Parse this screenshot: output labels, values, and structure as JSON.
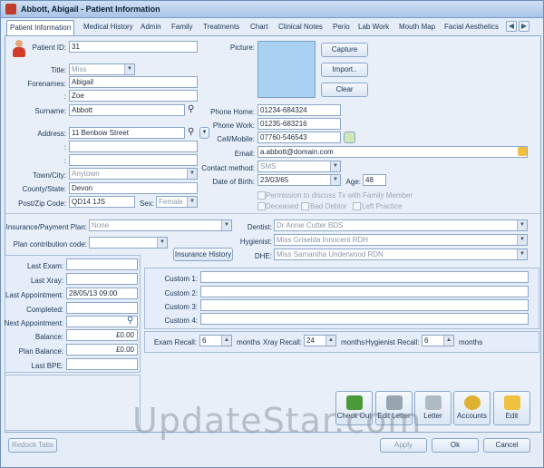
{
  "window": {
    "title": "Abbott, Abigail - Patient Information"
  },
  "tabs": [
    "Patient Information",
    "Medical History",
    "Admin",
    "Family",
    "Treatments",
    "Chart",
    "Clinical Notes",
    "Perio",
    "Lab Work",
    "Mouth Map",
    "Facial Aesthetics"
  ],
  "nav": {
    "prev": "◀",
    "next": "▶"
  },
  "patient": {
    "id_label": "Patient ID:",
    "id": "31",
    "title_label": "Title:",
    "title": "Miss",
    "forenames_label": "Forenames:",
    "forename1": "Abigail",
    "colon": ":",
    "forename2": "Zoe",
    "surname_label": "Surname:",
    "surname": "Abbott",
    "address_label": "Address:",
    "address1": "11 Benbow Street",
    "address2": "",
    "address3": "",
    "town_label": "Town/City:",
    "town": "Anytown",
    "county_label": "County/State:",
    "county": "Devon",
    "post_label": "Post/Zip Code:",
    "post": "QD14 1JS",
    "sex_label": "Sex:",
    "sex": "Female"
  },
  "picture": {
    "label": "Picture:",
    "capture": "Capture",
    "import": "Import..",
    "clear": "Clear"
  },
  "contact": {
    "home_label": "Phone Home:",
    "home": "01234-684324",
    "work_label": "Phone Work:",
    "work": "01235-683216",
    "cell_label": "Cell/Mobile:",
    "cell": "07760-546543",
    "email_label": "Email:",
    "email": "a.abbott@domain.com",
    "method_label": "Contact method:",
    "method": "SMS",
    "dob_label": "Date of Birth:",
    "dob": "23/03/65",
    "age_label": "Age:",
    "age": "48"
  },
  "flags": {
    "permission": "Permission to discuss Tx with Family Member",
    "deceased": "Deceased",
    "bad_debtor": "Bad Debtor",
    "left_practice": "Left Practice"
  },
  "insurance": {
    "plan_label": "Insurance/Payment Plan:",
    "plan": "None",
    "contrib_label": "Plan contribution code:",
    "contrib": "",
    "history_btn": "Insurance History"
  },
  "staff": {
    "dentist_label": "Dentist:",
    "dentist": "Dr Annie Cutter BDS",
    "hygienist_label": "Hygienist:",
    "hygienist": "Miss Griselda Innocent RDH",
    "dhe_label": "DHE:",
    "dhe": "Miss Samantha Underwood RDN"
  },
  "history": {
    "last_exam_label": "Last Exam:",
    "last_exam": "",
    "last_xray_label": "Last Xray:",
    "last_xray": "",
    "last_appt_label": "Last Appointment:",
    "last_appt": "28/05/13 09:00",
    "completed_label": "Completed:",
    "completed": "",
    "next_appt_label": "Next Appointment:",
    "next_appt": "",
    "balance_label": "Balance:",
    "balance": "£0.00",
    "plan_balance_label": "Plan Balance:",
    "plan_balance": "£0.00",
    "last_bpe_label": "Last BPE:",
    "last_bpe": ""
  },
  "custom": {
    "c1": "Custom 1:",
    "c2": "Custom 2:",
    "c3": "Custom 3:",
    "c4": "Custom 4:"
  },
  "recall": {
    "exam_label": "Exam Recall:",
    "exam": "6",
    "exam_unit": "months",
    "xray_label": "Xray Recall:",
    "xray": "24",
    "xray_unit": "months",
    "hyg_label": "Hygienist Recall:",
    "hyg": "6",
    "hyg_unit": "months"
  },
  "actions": {
    "checkout": "Check Out",
    "edit_letter": "Edit Letter",
    "letter": "Letter",
    "accounts": "Accounts",
    "edit": "Edit"
  },
  "footer": {
    "redock": "Redock Tabs",
    "apply": "Apply",
    "ok": "Ok",
    "cancel": "Cancel"
  },
  "watermark": "UpdateStar.com"
}
